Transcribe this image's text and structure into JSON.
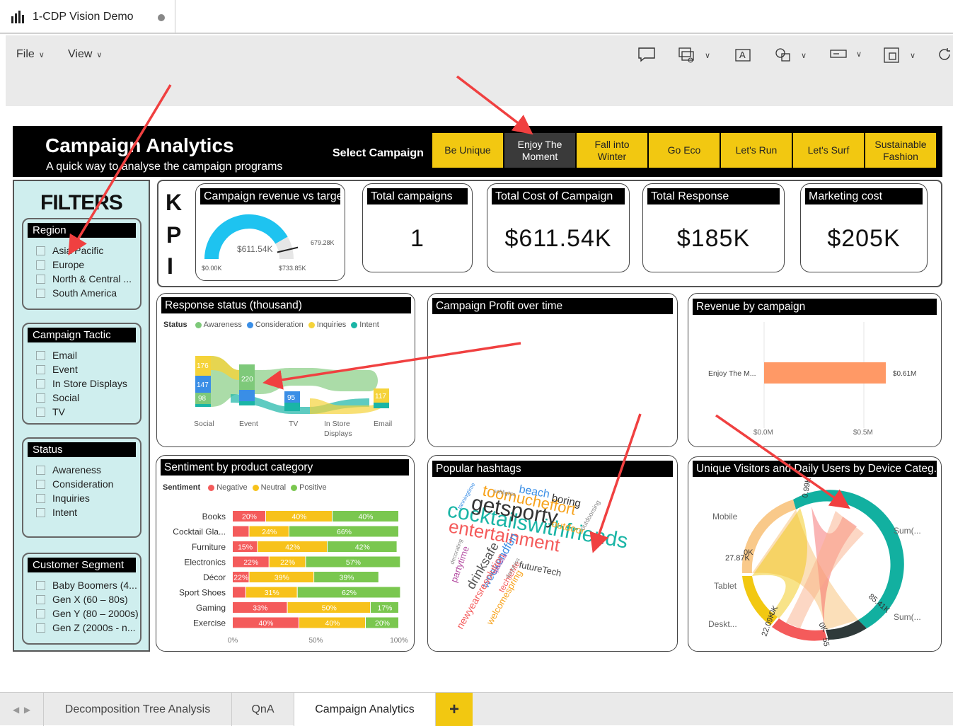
{
  "app": {
    "title": "1-CDP Vision Demo"
  },
  "menu": {
    "file": "File",
    "view": "View"
  },
  "header": {
    "title": "Campaign Analytics",
    "subtitle": "A quick way to analyse the campaign programs",
    "select_label": "Select Campaign",
    "campaigns": [
      "Be Unique",
      "Enjoy The Moment",
      "Fall into Winter",
      "Go Eco",
      "Let's Run",
      "Let's Surf",
      "Sustainable Fashion"
    ],
    "active_campaign": "Enjoy The Moment",
    "accent": "#f2c811"
  },
  "filters": {
    "title": "FILTERS",
    "groups": [
      {
        "name": "Region",
        "items": [
          "Asia Pacific",
          "Europe",
          "North & Central ...",
          "South America"
        ]
      },
      {
        "name": "Campaign Tactic",
        "items": [
          "Email",
          "Event",
          "In Store Displays",
          "Social",
          "TV"
        ]
      },
      {
        "name": "Status",
        "items": [
          "Awareness",
          "Consideration",
          "Inquiries",
          "Intent"
        ]
      },
      {
        "name": "Customer Segment",
        "items": [
          "Baby Boomers (4...",
          "Gen X (60 – 80s)",
          "Gen Y (80 – 2000s)",
          "Gen Z (2000s - n..."
        ]
      }
    ]
  },
  "kpi": {
    "letters": [
      "K",
      "P",
      "I"
    ],
    "revenue_gauge": {
      "title": "Campaign revenue vs target",
      "value_label": "$611.54K",
      "min_label": "$0.00K",
      "max_label": "$733.85K",
      "target_label": "679.28K",
      "value": 611.54,
      "max": 733.85,
      "target": 679.28
    },
    "cards": [
      {
        "title": "Total campaigns",
        "value": "1"
      },
      {
        "title": "Total Cost of Campaign",
        "value": "$611.54K"
      },
      {
        "title": "Total Response",
        "value": "$185K"
      },
      {
        "title": "Marketing cost",
        "value": "$205K"
      }
    ]
  },
  "response_status": {
    "title": "Response status (thousand)",
    "legend_title": "Status",
    "legend": [
      {
        "name": "Awareness",
        "color": "#7ec97a"
      },
      {
        "name": "Consideration",
        "color": "#3a8ee6"
      },
      {
        "name": "Inquiries",
        "color": "#f5d33a"
      },
      {
        "name": "Intent",
        "color": "#1ab5a6"
      }
    ],
    "categories": [
      "Social",
      "Event",
      "TV",
      "In Store Displays",
      "Email"
    ],
    "labels": [
      "176",
      "147",
      "98",
      "220",
      "95",
      "117"
    ]
  },
  "profit_over_time": {
    "title": "Campaign Profit over time"
  },
  "revenue_by_campaign": {
    "title": "Revenue by campaign",
    "chart_data": {
      "type": "bar",
      "categories": [
        "Enjoy The M..."
      ],
      "values": [
        0.61
      ],
      "value_labels": [
        "$0.61M"
      ],
      "xticks": [
        "$0.0M",
        "$0.5M"
      ],
      "color": "#ff9966"
    }
  },
  "sentiment": {
    "title": "Sentiment by product category",
    "legend_title": "Sentiment",
    "legend": [
      {
        "name": "Negative",
        "color": "#f45b5b"
      },
      {
        "name": "Neutral",
        "color": "#f7c21b"
      },
      {
        "name": "Positive",
        "color": "#7ac74f"
      }
    ],
    "chart_data": {
      "type": "bar",
      "stacked": true,
      "categories": [
        "Books",
        "Cocktail Gla...",
        "Furniture",
        "Electronics",
        "Décor",
        "Sport Shoes",
        "Gaming",
        "Exercise"
      ],
      "series": [
        {
          "name": "Negative",
          "values": [
            20,
            10,
            15,
            22,
            10,
            8,
            33,
            40
          ]
        },
        {
          "name": "Neutral",
          "values": [
            40,
            24,
            42,
            22,
            39,
            31,
            50,
            40
          ]
        },
        {
          "name": "Positive",
          "values": [
            40,
            66,
            42,
            57,
            39,
            62,
            17,
            20
          ]
        }
      ],
      "shown_labels": [
        [
          "20%",
          "40%",
          "40%"
        ],
        [
          "",
          "24%",
          "66%"
        ],
        [
          "15%",
          "42%",
          "42%"
        ],
        [
          "22%",
          "22%",
          "57%"
        ],
        [
          "22%",
          "39%",
          "39%"
        ],
        [
          "",
          "31%",
          "62%"
        ],
        [
          "33%",
          "50%",
          "17%"
        ],
        [
          "40%",
          "40%",
          "20%"
        ]
      ],
      "xticks": [
        "0%",
        "50%",
        "100%"
      ]
    }
  },
  "hashtags": {
    "title": "Popular hashtags",
    "words": [
      "cocktailswithfriends",
      "getsporty",
      "entertainment",
      "toomucheffort",
      "boring",
      "beach",
      "outdoor",
      "drinksafe",
      "weekendfun",
      "newyearsresolution",
      "partytime",
      "futureTech",
      "welcomespring",
      "techieMe",
      "outdoorsing",
      "softlights",
      "tanningtime",
      "sportscar",
      "dontmiss",
      "decorating"
    ]
  },
  "unique_visitors": {
    "title": "Unique Visitors and Daily Users by Device Categ...",
    "labels": [
      "Mobile",
      "Tablet",
      "Deskt...",
      "Sum(...",
      "Sum(..."
    ],
    "axis_labels": [
      "0K",
      "27.87K",
      "0.99K",
      "85.41K",
      "22.09K",
      "0K",
      "55",
      "0K"
    ]
  },
  "tabs": {
    "items": [
      "Decomposition Tree Analysis",
      "QnA",
      "Campaign Analytics"
    ],
    "active": "Campaign Analytics",
    "add": "+"
  }
}
